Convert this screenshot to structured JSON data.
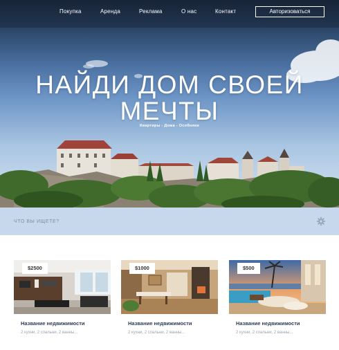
{
  "nav": {
    "links": [
      "Покупка",
      "Аренда",
      "Реклама",
      "О нас",
      "Контакт"
    ],
    "login_label": "Авторизоваться"
  },
  "hero": {
    "title_line1": "НАЙДИ ДОМ СВОЕЙ",
    "title_line2": "МЕЧТЫ",
    "subtitle": "Квартиры - Дома - Особняки"
  },
  "search": {
    "placeholder": "ЧТО ВЫ ИЩЕТЕ?"
  },
  "listings": [
    {
      "price": "$2500",
      "name": "Название недвижимости",
      "meta": "2 кухни, 2 спальни, 2 ванны..."
    },
    {
      "price": "$1000",
      "name": "Название недвижимости",
      "meta": "2 кухни, 2 спальни, 2 ванны..."
    },
    {
      "price": "$500",
      "name": "Название недвижимости",
      "meta": "2 кухни, 2 спальни, 2 ванны..."
    }
  ],
  "colors": {
    "search_bar": "#c7d8ed",
    "sky_top": "#1e2b3f",
    "sky_bottom": "#d6e5f3",
    "card_title": "#2c3e55"
  },
  "icons": [
    "gear-icon"
  ]
}
